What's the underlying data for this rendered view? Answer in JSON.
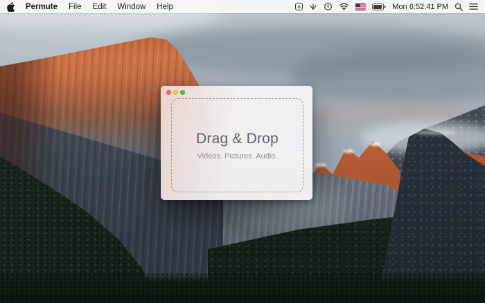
{
  "menu_bar": {
    "app_name": "Permute",
    "menus": [
      "File",
      "Edit",
      "Window",
      "Help"
    ],
    "status": {
      "a_badge_letter": "a",
      "clock": "Mon 6:52:41 PM",
      "icons": [
        "a-badge-icon",
        "fan-icon",
        "time-machine-icon",
        "wifi-icon",
        "us-flag-icon",
        "battery-icon",
        "spotlight-search-icon",
        "notification-center-icon"
      ]
    }
  },
  "window": {
    "drop_zone": {
      "title": "Drag & Drop",
      "subtitle": "Videos. Pictures. Audio."
    },
    "traffic_lights": {
      "close": "#fd5d55",
      "minimize": "#f8bd46",
      "zoom": "#35c64b"
    }
  },
  "colors": {
    "menu_text": "#1d1d1f",
    "drop_border": "#9b9b9b",
    "drop_title": "#606266",
    "drop_subtitle": "#909295"
  }
}
